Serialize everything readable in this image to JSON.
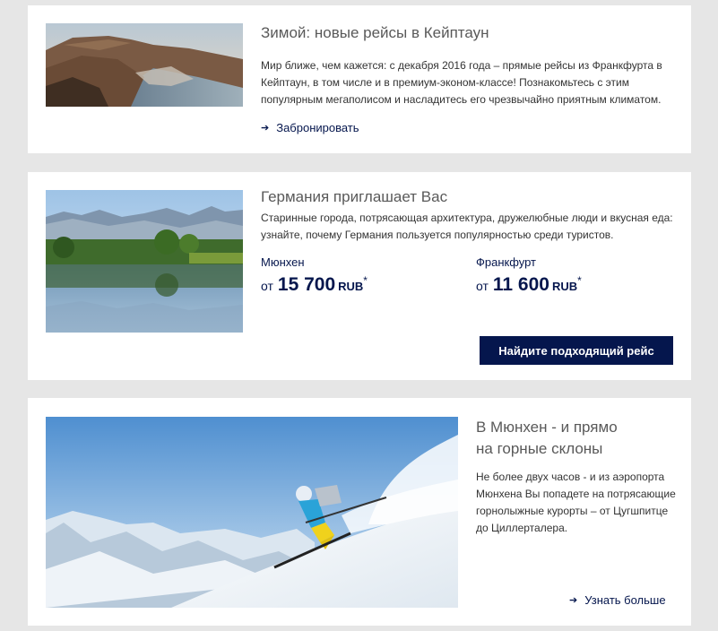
{
  "capetown": {
    "title": "Зимой: новые рейсы в Кейптаун",
    "text": "Мир ближе, чем кажется: с декабря 2016 года – прямые рейсы из Франкфурта в Кейптаун, в том числе и в премиум-эконом-классе! Познакомьтесь с этим популярным мегаполисом и насладитесь его чрезвычайно приятным климатом.",
    "link": "Забронировать",
    "link_icon": "arrow-right-icon",
    "image_icon": "cape-town-photo"
  },
  "germany": {
    "title": "Германия приглашает Вас",
    "text": "Старинные города, потрясающая архитектура, дружелюбные люди и вкусная еда: узнайте, почему Германия пользуется популярностью среди туристов.",
    "image_icon": "lake-mountains-photo",
    "offers": [
      {
        "city": "Мюнхен",
        "from": "от",
        "price": "15 700",
        "currency": "RUB",
        "mark": "*"
      },
      {
        "city": "Франкфурт",
        "from": "от",
        "price": "11 600",
        "currency": "RUB",
        "mark": "*"
      }
    ],
    "button": "Найдите подходящий рейс"
  },
  "munich": {
    "title_line1": "В Мюнхен - и прямо",
    "title_line2": "на горные склоны",
    "text": "Не более двух часов - и из аэропорта Мюнхена Вы попадете на потрясающие горнолыжные курорты – от Цугшпитце до Циллерталера.",
    "link": "Узнать больше",
    "link_icon": "arrow-right-icon",
    "image_icon": "skier-photo"
  },
  "colors": {
    "brand_navy": "#05164d",
    "background": "#e6e6e6"
  }
}
